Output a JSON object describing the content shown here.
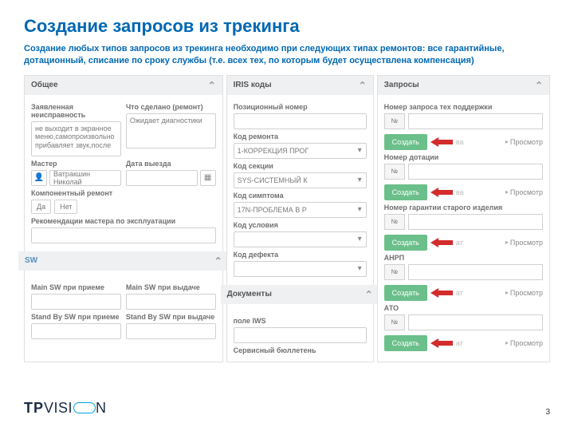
{
  "title": "Создание запросов из трекинга",
  "subtitle": "Создание любых типов запросов из трекинга необходимо при следующих типах ремонтов: все гарантийные, дотационный, списание по сроку службы (т.е. всех тех, по которым будет осуществлена компенсация)",
  "general": {
    "header": "Общее",
    "fault_lbl": "Заявленная неисправность",
    "fault_val": "не выходит в экранное меню,самопроизвольно прибавляет звук,после",
    "done_lbl": "Что сделано (ремонт)",
    "done_val": "Ожидает диагностики",
    "master_lbl": "Мастер",
    "master_val": "Ватракшин Николай",
    "date_lbl": "Дата выезда",
    "comp_lbl": "Компонентный ремонт",
    "yes": "Да",
    "no": "Нет",
    "rec_lbl": "Рекомендации мастера по эксплуатации"
  },
  "sw": {
    "header": "SW",
    "main_in_lbl": "Main SW при приеме",
    "main_out_lbl": "Main SW при выдаче",
    "standby_in_lbl": "Stand By SW при приеме",
    "standby_out_lbl": "Stand By SW при выдаче"
  },
  "iris": {
    "header": "IRIS коды",
    "pos_lbl": "Позиционный номер",
    "repair_lbl": "Код ремонта",
    "repair_val": "1-КОРРЕКЦИЯ ПРОГ",
    "section_lbl": "Код секции",
    "section_val": "SYS-СИСТЕМНЫЙ К",
    "symptom_lbl": "Код симптома",
    "symptom_val": "17N-ПРОБЛЕМА В Р",
    "cond_lbl": "Код условия",
    "defect_lbl": "Код дефекта"
  },
  "docs": {
    "header": "Документы",
    "iws_lbl": "поле IWS",
    "sb_lbl": "Сервисный бюллетень"
  },
  "requests": {
    "header": "Запросы",
    "num_short": "№",
    "create": "Создать",
    "view": "Просмотр",
    "hidden_suffix": "ва",
    "hidden_suffix_alt": "ат",
    "tech_lbl": "Номер запроса тех поддержки",
    "subsidy_lbl": "Номер дотации",
    "warranty_old_lbl": "Номер гарантии старого изделия",
    "anrp_lbl": "АНРП",
    "ato_lbl": "АТО"
  },
  "footer": {
    "page": "3",
    "brand_tp": "TP",
    "brand_rest": "VISI",
    "brand_n": "N"
  }
}
